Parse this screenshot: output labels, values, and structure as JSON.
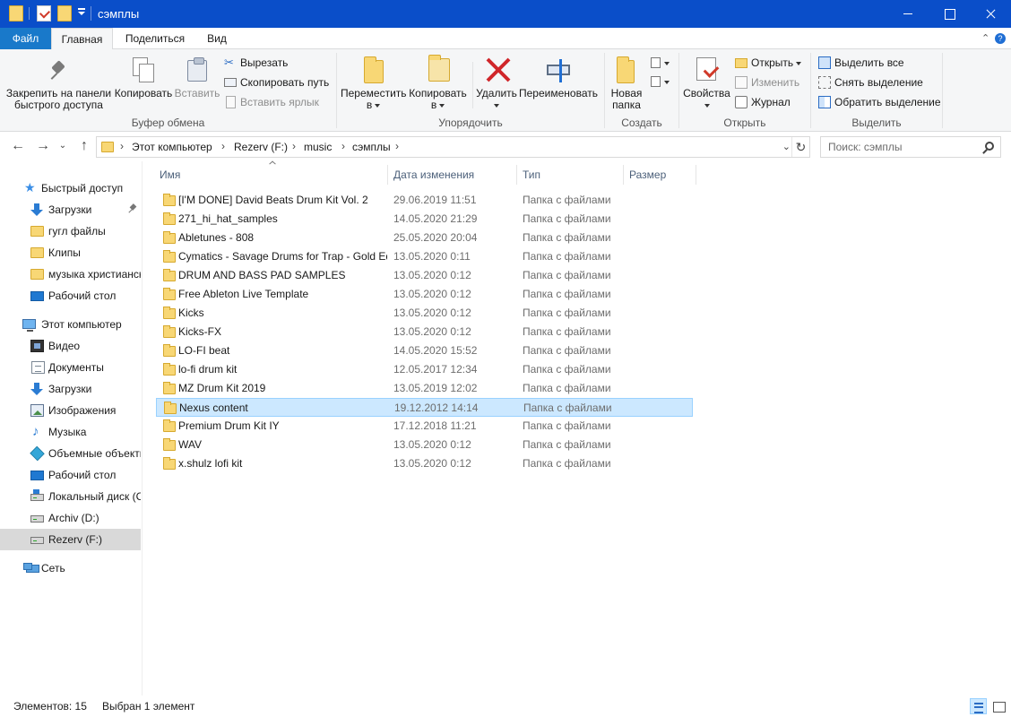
{
  "window": {
    "title": "сэмплы"
  },
  "ribbon_tabs": [
    {
      "label": "Файл"
    },
    {
      "label": "Главная"
    },
    {
      "label": "Поделиться"
    },
    {
      "label": "Вид"
    }
  ],
  "ribbon": {
    "clipboard": {
      "group_label": "Буфер обмена",
      "pin_line1": "Закрепить на панели",
      "pin_line2": "быстрого доступа",
      "copy": "Копировать",
      "paste": "Вставить",
      "cut": "Вырезать",
      "copy_path": "Скопировать путь",
      "paste_shortcut": "Вставить ярлык"
    },
    "organize": {
      "group_label": "Упорядочить",
      "move_line1": "Переместить",
      "move_line2": "в",
      "copyto_line1": "Копировать",
      "copyto_line2": "в",
      "delete": "Удалить",
      "rename": "Переименовать"
    },
    "create": {
      "group_label": "Создать",
      "new_folder_line1": "Новая",
      "new_folder_line2": "папка"
    },
    "open": {
      "group_label": "Открыть",
      "properties": "Свойства",
      "open": "Открыть",
      "edit": "Изменить",
      "history": "Журнал"
    },
    "select": {
      "group_label": "Выделить",
      "select_all": "Выделить все",
      "select_none": "Снять выделение",
      "invert": "Обратить выделение"
    }
  },
  "breadcrumb": [
    "Этот компьютер",
    "Rezerv (F:)",
    "music",
    "сэмплы"
  ],
  "search": {
    "placeholder": "Поиск: сэмплы"
  },
  "sidebar": {
    "quick_access": "Быстрый доступ",
    "quick_items": [
      {
        "label": "Загрузки",
        "icon": "downloads-icon",
        "pinned": true
      },
      {
        "label": "гугл файлы",
        "icon": "folder-icon"
      },
      {
        "label": "Клипы",
        "icon": "folder-icon"
      },
      {
        "label": "музыка христианская",
        "icon": "folder-icon"
      },
      {
        "label": "Рабочий стол",
        "icon": "desktop-icon"
      }
    ],
    "this_pc": "Этот компьютер",
    "pc_items": [
      {
        "label": "Видео",
        "icon": "video-icon"
      },
      {
        "label": "Документы",
        "icon": "documents-icon"
      },
      {
        "label": "Загрузки",
        "icon": "downloads-icon"
      },
      {
        "label": "Изображения",
        "icon": "pictures-icon"
      },
      {
        "label": "Музыка",
        "icon": "music-icon"
      },
      {
        "label": "Объемные объекты",
        "icon": "3d-objects-icon"
      },
      {
        "label": "Рабочий стол",
        "icon": "desktop-icon"
      },
      {
        "label": "Локальный диск (C:)",
        "icon": "drive-icon"
      },
      {
        "label": "Archiv (D:)",
        "icon": "drive-icon"
      },
      {
        "label": "Rezerv (F:)",
        "icon": "drive-icon",
        "selected": true
      }
    ],
    "network": "Сеть"
  },
  "columns": {
    "name": "Имя",
    "date": "Дата изменения",
    "type": "Тип",
    "size": "Размер"
  },
  "files": [
    {
      "name": "[I'M DONE] David Beats Drum Kit Vol. 2",
      "date": "29.06.2019 11:51",
      "type": "Папка с файлами"
    },
    {
      "name": "271_hi_hat_samples",
      "date": "14.05.2020 21:29",
      "type": "Папка с файлами"
    },
    {
      "name": "Abletunes - 808",
      "date": "25.05.2020 20:04",
      "type": "Папка с файлами"
    },
    {
      "name": "Cymatics - Savage Drums for Trap - Gold Edition",
      "date": "13.05.2020 0:11",
      "type": "Папка с файлами"
    },
    {
      "name": "DRUM AND BASS PAD SAMPLES",
      "date": "13.05.2020 0:12",
      "type": "Папка с файлами"
    },
    {
      "name": "Free Ableton Live Template",
      "date": "13.05.2020 0:12",
      "type": "Папка с файлами"
    },
    {
      "name": "Kicks",
      "date": "13.05.2020 0:12",
      "type": "Папка с файлами"
    },
    {
      "name": "Kicks-FX",
      "date": "13.05.2020 0:12",
      "type": "Папка с файлами"
    },
    {
      "name": "LO-FI beat",
      "date": "14.05.2020 15:52",
      "type": "Папка с файлами"
    },
    {
      "name": "lo-fi drum kit",
      "date": "12.05.2017 12:34",
      "type": "Папка с файлами"
    },
    {
      "name": "MZ Drum Kit 2019",
      "date": "13.05.2019 12:02",
      "type": "Папка с файлами"
    },
    {
      "name": "Nexus content",
      "date": "19.12.2012 14:14",
      "type": "Папка с файлами",
      "selected": true
    },
    {
      "name": "Premium Drum Kit IY",
      "date": "17.12.2018 11:21",
      "type": "Папка с файлами"
    },
    {
      "name": "WAV",
      "date": "13.05.2020 0:12",
      "type": "Папка с файлами"
    },
    {
      "name": "x.shulz lofi kit",
      "date": "13.05.2020 0:12",
      "type": "Папка с файлами"
    }
  ],
  "status": {
    "count": "Элементов: 15",
    "selected": "Выбран 1 элемент"
  },
  "colors": {
    "titlebar": "#0a4ec9",
    "file_tab": "#1979ca",
    "selection": "#cce8ff",
    "folder": "#f8d775"
  }
}
